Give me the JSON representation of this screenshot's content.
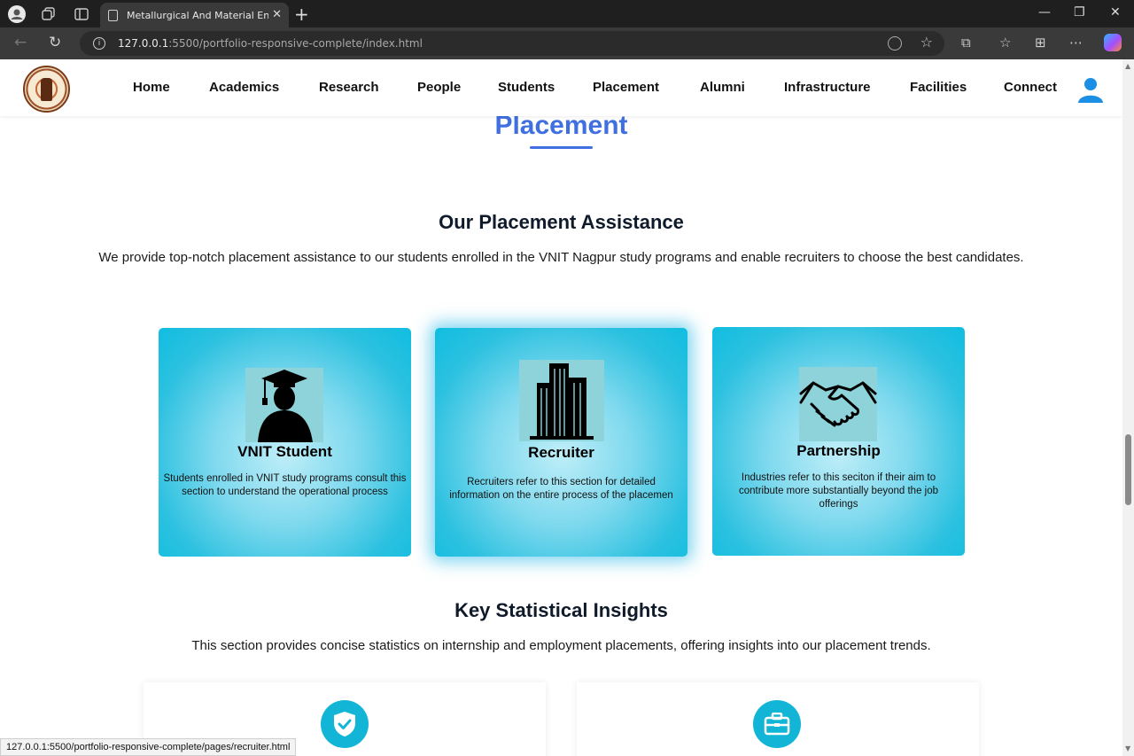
{
  "browser": {
    "tab_title": "Metallurgical And Material Engine",
    "url_host": "127.0.0.1",
    "url_path": ":5500/portfolio-responsive-complete/index.html",
    "status_url": "127.0.0.1:5500/portfolio-responsive-complete/pages/recruiter.html"
  },
  "nav": {
    "items": [
      "Home",
      "Academics",
      "Research",
      "People",
      "Students",
      "Placement",
      "Alumni",
      "Infrastructure",
      "Facilities",
      "Connect"
    ]
  },
  "section": {
    "title": "Placement"
  },
  "assistance": {
    "heading": "Our Placement Assistance",
    "text": "We provide top-notch placement assistance to our students enrolled in the VNIT Nagpur study programs and enable recruiters to choose the best candidates."
  },
  "cards": [
    {
      "title": "VNIT Student",
      "desc": "Students enrolled in VNIT study programs consult this\nsection to understand the operational process",
      "icon": "graduate-icon"
    },
    {
      "title": "Recruiter",
      "desc": "Recruiters refer to this section for detailed\ninformation on the entire process of the placemen",
      "icon": "building-icon"
    },
    {
      "title": "Partnership",
      "desc": "Industries refer to this seciton if their aim to\ncontribute more substantially beyond the job\nofferings",
      "icon": "handshake-icon"
    }
  ],
  "insights": {
    "heading": "Key Statistical Insights",
    "text": "This section provides concise statistics on internship and employment placements, offering insights into our placement trends."
  },
  "stat_cards": [
    {
      "icon": "shield-check-icon"
    },
    {
      "icon": "briefcase-icon"
    }
  ],
  "colors": {
    "accent": "#3f6fe0",
    "card": "#10bde0",
    "user_icon": "#1a8fe3"
  }
}
